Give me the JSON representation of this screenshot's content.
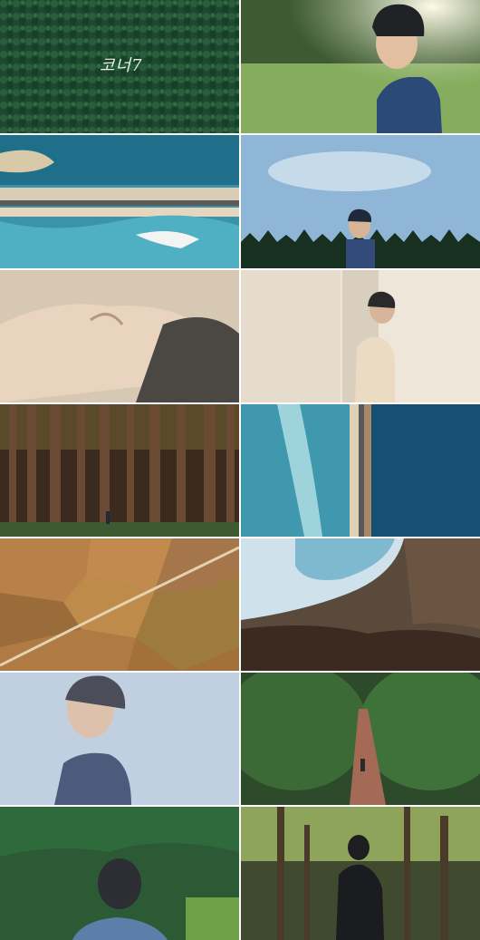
{
  "collage": {
    "title_script": "코너7",
    "tiles": [
      {
        "id": "forest-top-aerial"
      },
      {
        "id": "man-profile-field-sunlight"
      },
      {
        "id": "coastal-road-aerial"
      },
      {
        "id": "man-profile-sky-treeline"
      },
      {
        "id": "face-closeup-lying"
      },
      {
        "id": "man-white-shirt-window"
      },
      {
        "id": "tall-forest-walker"
      },
      {
        "id": "coast-road-vertical-aerial"
      },
      {
        "id": "farm-fields-aerial"
      },
      {
        "id": "wave-over-rocks"
      },
      {
        "id": "man-blurred-profile-sky"
      },
      {
        "id": "forest-path-stairs"
      },
      {
        "id": "man-back-hills"
      },
      {
        "id": "man-back-forest-silhouette"
      }
    ]
  }
}
